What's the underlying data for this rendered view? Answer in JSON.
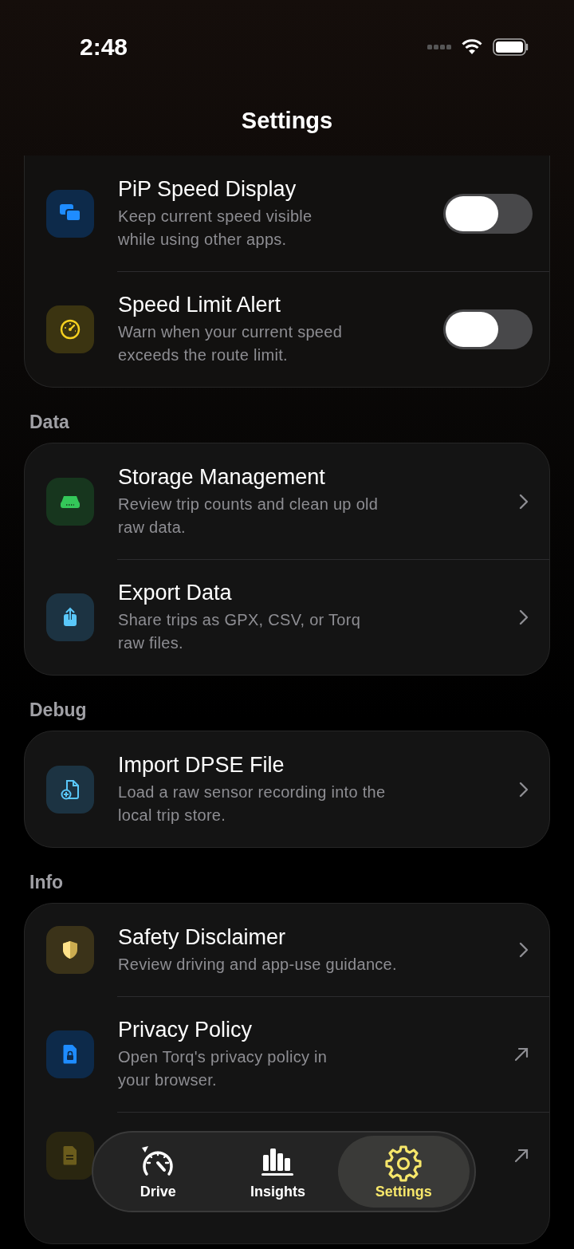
{
  "status_bar": {
    "time": "2:48"
  },
  "header": {
    "title": "Settings"
  },
  "sections": [
    {
      "items": [
        {
          "kind": "toggle",
          "title": "PiP Speed Display",
          "subtitle": "Keep current speed visible\nwhile using other apps.",
          "on": false
        },
        {
          "kind": "toggle",
          "title": "Speed Limit Alert",
          "subtitle": "Warn when your current speed\nexceeds the route limit.",
          "on": false
        }
      ]
    },
    {
      "label": "Data",
      "items": [
        {
          "kind": "link",
          "title": "Storage Management",
          "subtitle": "Review trip counts and clean up old\nraw data."
        },
        {
          "kind": "link",
          "title": "Export Data",
          "subtitle": "Share trips as GPX, CSV, or Torq\nraw files."
        }
      ]
    },
    {
      "label": "Debug",
      "items": [
        {
          "kind": "link",
          "title": "Import DPSE File",
          "subtitle": "Load a raw sensor recording into the\nlocal trip store."
        }
      ]
    },
    {
      "label": "Info",
      "items": [
        {
          "kind": "link",
          "title": "Safety Disclaimer",
          "subtitle": "Review driving and app-use guidance."
        },
        {
          "kind": "external",
          "title": "Privacy Policy",
          "subtitle": "Open Torq's privacy policy in\nyour browser."
        },
        {
          "kind": "external"
        }
      ]
    }
  ],
  "tab_bar": {
    "tabs": [
      {
        "label": "Drive",
        "selected": false
      },
      {
        "label": "Insights",
        "selected": false
      },
      {
        "label": "Settings",
        "selected": true
      }
    ]
  }
}
